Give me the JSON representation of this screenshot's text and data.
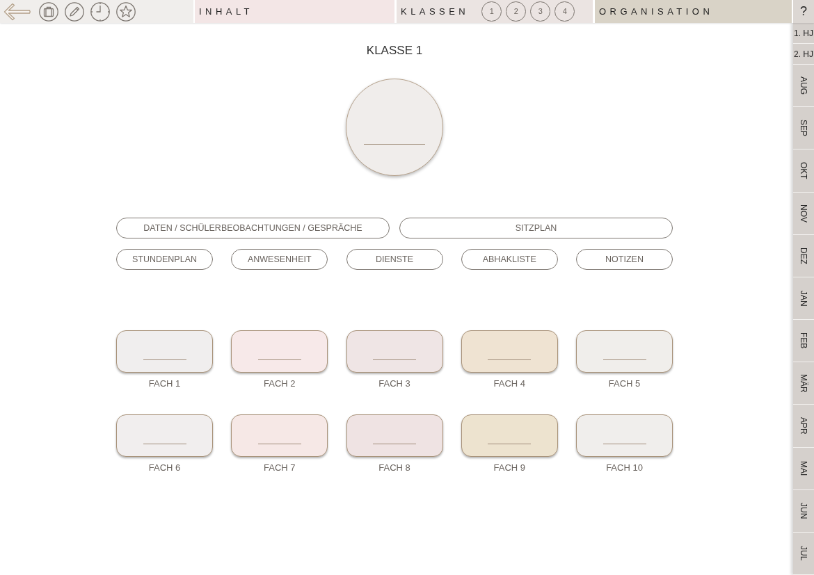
{
  "nav_sections": [
    {
      "label": "INHALT",
      "color": "#f3e6e6"
    },
    {
      "label": "KLASSEN",
      "color": "#ebe4e2",
      "class_numbers": [
        "1",
        "2",
        "3",
        "4"
      ]
    },
    {
      "label": "ORGANISATION",
      "color": "#d9d3c7"
    }
  ],
  "help_button": "?",
  "title": "KLASSE 1",
  "buttons_row_1": [
    "DATEN / SCHÜLERBEOBACHTUNGEN / GESPRÄCHE",
    "SITZPLAN"
  ],
  "buttons_row_2": [
    "STUNDENPLAN",
    "ANWESENHEIT",
    "DIENSTE",
    "ABHAKLISTE",
    "NOTIZEN"
  ],
  "subjects": [
    {
      "label": "FACH 1",
      "color": "#f0eeee"
    },
    {
      "label": "FACH 2",
      "color": "#f7e9e9"
    },
    {
      "label": "FACH 3",
      "color": "#efe5e5"
    },
    {
      "label": "FACH 4",
      "color": "#efe3d2"
    },
    {
      "label": "FACH 5",
      "color": "#f0eeeb"
    },
    {
      "label": "FACH 6",
      "color": "#f1eeee"
    },
    {
      "label": "FACH 7",
      "color": "#f6e8e6"
    },
    {
      "label": "FACH 8",
      "color": "#efe3e3"
    },
    {
      "label": "FACH 9",
      "color": "#ede3cf"
    },
    {
      "label": "FACH 10",
      "color": "#f0eeec"
    }
  ],
  "sidebar": {
    "tabs": [
      {
        "kind": "half-year",
        "label": "1. HJ"
      },
      {
        "kind": "half-year",
        "label": "2. HJ"
      },
      {
        "kind": "month",
        "label": "AUG"
      },
      {
        "kind": "month",
        "label": "SEP"
      },
      {
        "kind": "month",
        "label": "OKT"
      },
      {
        "kind": "month",
        "label": "NOV"
      },
      {
        "kind": "month",
        "label": "DEZ"
      },
      {
        "kind": "month",
        "label": "JAN"
      },
      {
        "kind": "month",
        "label": "FEB"
      },
      {
        "kind": "month",
        "label": "MÄR"
      },
      {
        "kind": "month",
        "label": "APR"
      },
      {
        "kind": "month",
        "label": "MAI"
      },
      {
        "kind": "month",
        "label": "JUN"
      },
      {
        "kind": "month",
        "label": "JUL"
      }
    ]
  }
}
